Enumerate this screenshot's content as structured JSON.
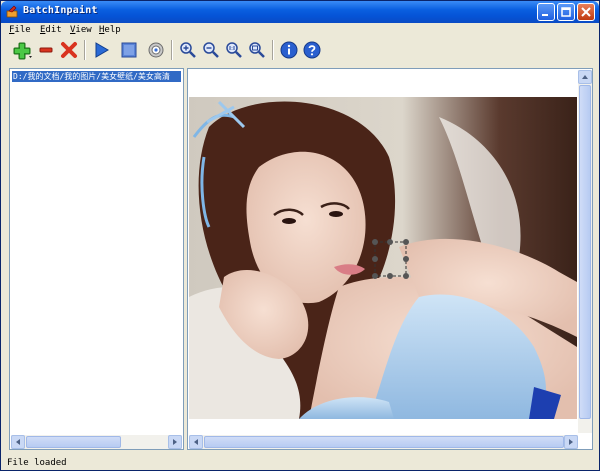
{
  "window": {
    "title": "BatchInpaint"
  },
  "menu": [
    {
      "accel": "F",
      "rest": "ile"
    },
    {
      "accel": "E",
      "rest": "dit"
    },
    {
      "accel": "V",
      "rest": "iew"
    },
    {
      "accel": "H",
      "rest": "elp"
    }
  ],
  "toolbar": {
    "icons": [
      "add-icon",
      "remove-icon",
      "delete-icon",
      "run-icon",
      "stop-icon",
      "settings-icon",
      "zoom-in-icon",
      "zoom-out-icon",
      "zoom-actual-icon",
      "zoom-fit-icon",
      "info-icon",
      "help-icon"
    ]
  },
  "file_list": {
    "items": [
      "D:/我的文档/我的图片/美女壁纸/美女高清"
    ]
  },
  "status": {
    "text": "File loaded"
  },
  "colors": {
    "titlebar": "#0553d6",
    "selection": "#316ac5",
    "chrome": "#ece9d8"
  }
}
